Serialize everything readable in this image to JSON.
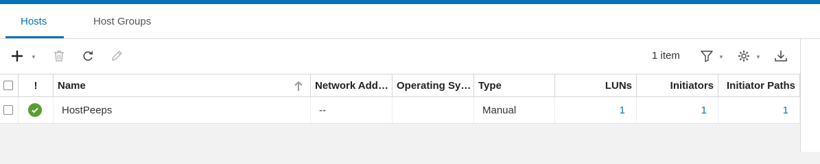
{
  "tabs": [
    {
      "label": "Hosts",
      "active": true
    },
    {
      "label": "Host Groups",
      "active": false
    }
  ],
  "toolbar": {
    "icons": [
      "plus-icon",
      "trash-icon",
      "refresh-icon",
      "pencil-icon",
      "filter-icon",
      "gear-icon",
      "download-icon"
    ],
    "item_count": "1 item"
  },
  "table": {
    "columns": [
      "!",
      "Name",
      "Network Add…",
      "Operating Sy…",
      "Type",
      "LUNs",
      "Initiators",
      "Initiator Paths"
    ],
    "sort_column": "Name",
    "rows": [
      {
        "status": "ok",
        "name": "HostPeeps",
        "network_address": "--",
        "operating_system": "",
        "type": "Manual",
        "luns": "1",
        "initiators": "1",
        "initiator_paths": "1"
      }
    ]
  },
  "colors": {
    "accent": "#0672b9",
    "status_ok": "#5a9e32"
  }
}
